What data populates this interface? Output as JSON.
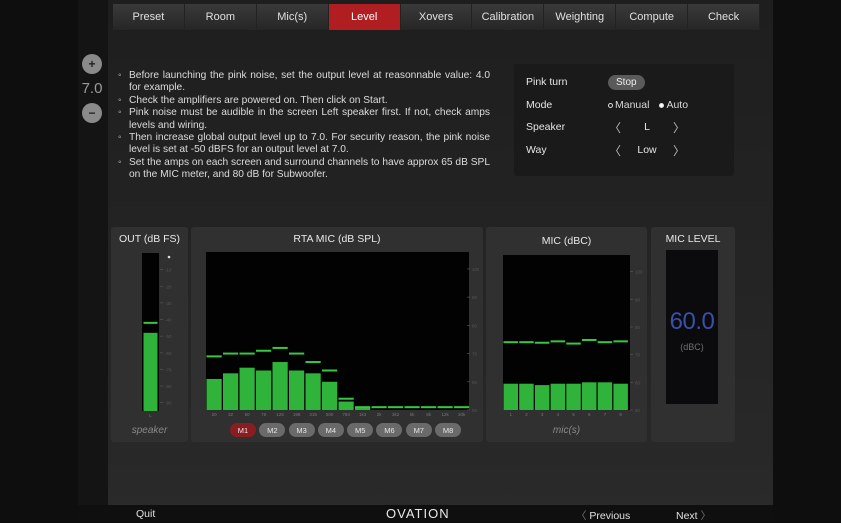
{
  "nav": {
    "tabs": [
      {
        "label": "Preset"
      },
      {
        "label": "Room"
      },
      {
        "label": "Mic(s)"
      },
      {
        "label": "Level"
      },
      {
        "label": "Xovers"
      },
      {
        "label": "Calibration"
      },
      {
        "label": "Weighting"
      },
      {
        "label": "Compute"
      },
      {
        "label": "Check"
      }
    ],
    "active_tab": "Level"
  },
  "level_stepper": {
    "plus": "+",
    "value": "7.0",
    "minus": "−"
  },
  "instructions": [
    "Before launching the pink noise, set the output level at reasonnable value: 4.0 for example.",
    "Check the amplifiers are powered on. Then click on Start.",
    "Pink noise must be audible in the screen Left speaker first. If not, check amps levels and wiring.",
    "Then increase global output level up to 7.0. For security reason, the pink noise level is set at -50 dBFS for an output level at 7.0.",
    "Set the amps on each screen and surround channels to have approx 65 dB SPL on the MIC meter, and 80 dB for Subwoofer."
  ],
  "settings": {
    "pink_turn_label": "Pink turn",
    "stop_label": "Stop",
    "mode_label": "Mode",
    "mode_manual": "Manual",
    "mode_auto": "Auto",
    "speaker_label": "Speaker",
    "speaker_value": "L",
    "way_label": "Way",
    "way_value": "Low",
    "chev_left": "〈",
    "chev_right": "〉"
  },
  "out_meter": {
    "title": "OUT (dB FS)",
    "footer": "speaker",
    "channel": "L"
  },
  "rta_meter": {
    "title": "RTA MIC (dB SPL)",
    "mic_buttons": [
      "M1",
      "M2",
      "M3",
      "M4",
      "M5",
      "M6",
      "M7",
      "M8"
    ],
    "active_mic": "M1"
  },
  "mic_meter": {
    "title": "MIC (dBC)",
    "footer": "mic(s)"
  },
  "mic_level": {
    "title": "MIC LEVEL",
    "value": "60.0",
    "unit": "(dBC)"
  },
  "footer": {
    "quit": "Quit",
    "logo": "OVATION",
    "previous": "Previous",
    "next": "Next",
    "prev_chev": "〈",
    "next_chev": "〉"
  },
  "colors": {
    "active_tab": "#b01e22",
    "bar": "#2fb33a",
    "peak": "#36c842",
    "level_text": "#3a4fa8"
  },
  "chart_data": [
    {
      "type": "bar",
      "title": "OUT (dB FS)",
      "categories": [
        "L"
      ],
      "values": [
        -48
      ],
      "peak": [
        -42
      ],
      "yticks": [
        -10,
        -20,
        -30,
        -40,
        -50,
        -60,
        -70,
        -80,
        -90
      ],
      "ylim": [
        -95,
        0
      ]
    },
    {
      "type": "bar",
      "title": "RTA MIC (dB SPL)",
      "categories": [
        "20",
        "32",
        "50",
        "79",
        "125",
        "198",
        "315",
        "500",
        "794",
        "1k3",
        "2k",
        "3k2",
        "5k",
        "8k",
        "12k",
        "20k"
      ],
      "values": [
        61,
        63,
        65,
        64,
        67,
        64,
        63,
        60,
        53,
        51,
        50,
        50,
        50,
        50,
        50,
        50
      ],
      "peak": [
        69,
        70,
        70,
        71,
        72,
        70,
        67,
        64,
        54,
        51,
        51,
        51,
        51,
        51,
        51,
        51
      ],
      "yticks": [
        100,
        90,
        80,
        70,
        60,
        50
      ],
      "ylim": [
        50,
        106
      ]
    },
    {
      "type": "bar",
      "title": "MIC (dBC)",
      "categories": [
        "1",
        "2",
        "3",
        "4",
        "5",
        "6",
        "7",
        "8"
      ],
      "values": [
        59.5,
        59.5,
        59,
        59.5,
        59.5,
        60,
        60,
        59.5
      ],
      "peak": [
        74.5,
        74.5,
        74.3,
        74.8,
        74,
        75.3,
        74.5,
        74.8
      ],
      "yticks": [
        100,
        90,
        80,
        70,
        60,
        50
      ],
      "ylim": [
        50,
        106
      ]
    }
  ]
}
